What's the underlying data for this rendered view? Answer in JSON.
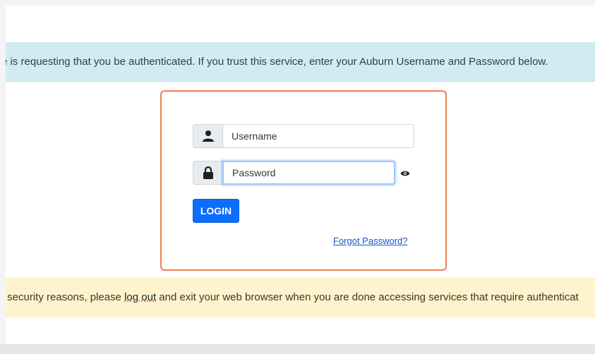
{
  "notice": {
    "text": "e is requesting that you be authenticated. If you trust this service, enter your Auburn Username and Password below."
  },
  "login": {
    "username_placeholder": "Username",
    "password_placeholder": "Password",
    "login_label": "LOGIN",
    "forgot_label": "Forgot Password?"
  },
  "warning": {
    "text_before": "r security reasons, please ",
    "logout_label": "log out",
    "text_after": " and exit your web browser when you are done accessing services that require authenticat"
  },
  "icons": {
    "username": "user-icon",
    "password": "lock-icon",
    "toggle": "eye-icon"
  },
  "colors": {
    "info_banner": "#d1ecf1",
    "warning_banner": "#fff3cd",
    "card_border": "#ef7c51",
    "primary_button": "#0d6efd"
  }
}
